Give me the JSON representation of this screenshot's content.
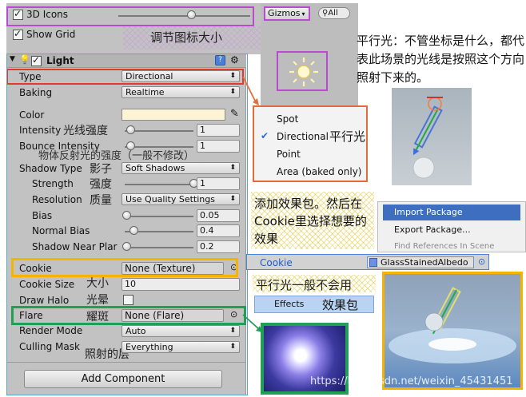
{
  "scene_view": {
    "icons_3d_label": "3D Icons",
    "icons_3d_checked": true,
    "icons_3d_size": 0.55,
    "show_grid_label": "Show Grid",
    "show_grid_checked": true,
    "gizmos_label": "Gizmos",
    "search_placeholder": "All"
  },
  "inspector": {
    "component_title": "Light",
    "type": {
      "label": "Type",
      "value": "Directional"
    },
    "baking": {
      "label": "Baking",
      "value": "Realtime"
    },
    "color": {
      "label": "Color",
      "hex": "#fdf4d6"
    },
    "intensity": {
      "label": "Intensity",
      "value": "1",
      "slider": 0.08
    },
    "bounce": {
      "label": "Bounce Intensity",
      "value": "1",
      "slider": 0.08
    },
    "shadow_type": {
      "label": "Shadow Type",
      "value": "Soft Shadows"
    },
    "strength": {
      "label": "Strength",
      "value": "1",
      "slider": 1.0
    },
    "resolution": {
      "label": "Resolution",
      "value": "Use Quality Settings"
    },
    "bias": {
      "label": "Bias",
      "value": "0.05",
      "slider": 0.02
    },
    "normal_bias": {
      "label": "Normal Bias",
      "value": "0.4",
      "slider": 0.13
    },
    "near_plane": {
      "label": "Shadow Near Plar",
      "value": "0.2",
      "slider": 0.02
    },
    "cookie": {
      "label": "Cookie",
      "value": "None (Texture)"
    },
    "cookie_size": {
      "label": "Cookie Size",
      "value": "10"
    },
    "draw_halo": {
      "label": "Draw Halo",
      "checked": false
    },
    "flare": {
      "label": "Flare",
      "value": "None (Flare)"
    },
    "render_mode": {
      "label": "Render Mode",
      "value": "Auto"
    },
    "culling_mask": {
      "label": "Culling Mask",
      "value": "Everything"
    },
    "add_component": "Add Component"
  },
  "type_menu": {
    "items": [
      "Spot",
      "Directional",
      "Point",
      "Area (baked only)"
    ],
    "selected": "Directional"
  },
  "context_menu": {
    "items": [
      "Import Package",
      "Export Package...",
      "Find References In Scene"
    ]
  },
  "cookie_row": {
    "label": "Cookie",
    "value": "GlassStainedAlbedo"
  },
  "effects_label": "Effects",
  "annotations": {
    "icon_size": "调节图标大小",
    "directional_desc": "平行光：不管坐标是什么，都代表此场景的光线是按照这个方向照射下来的。",
    "directional_cn": "平行光",
    "intensity_cn": "光线强度",
    "bounce_cn": "物体反射光的强度（一般不修改）",
    "shadow_type_cn": "影子",
    "strength_cn": "强度",
    "resolution_cn": "质量",
    "cookie_note": "添加效果包。然后在Cookie里选择想要的效果",
    "cookie_rare": "平行光一般不会用",
    "effects_cn": "效果包",
    "cookie_size_cn": "大小",
    "halo_cn": "光晕",
    "flare_cn": "耀斑",
    "culling_cn": "照射的层"
  },
  "watermark": "https://blog.csdn.net/weixin_45431451"
}
